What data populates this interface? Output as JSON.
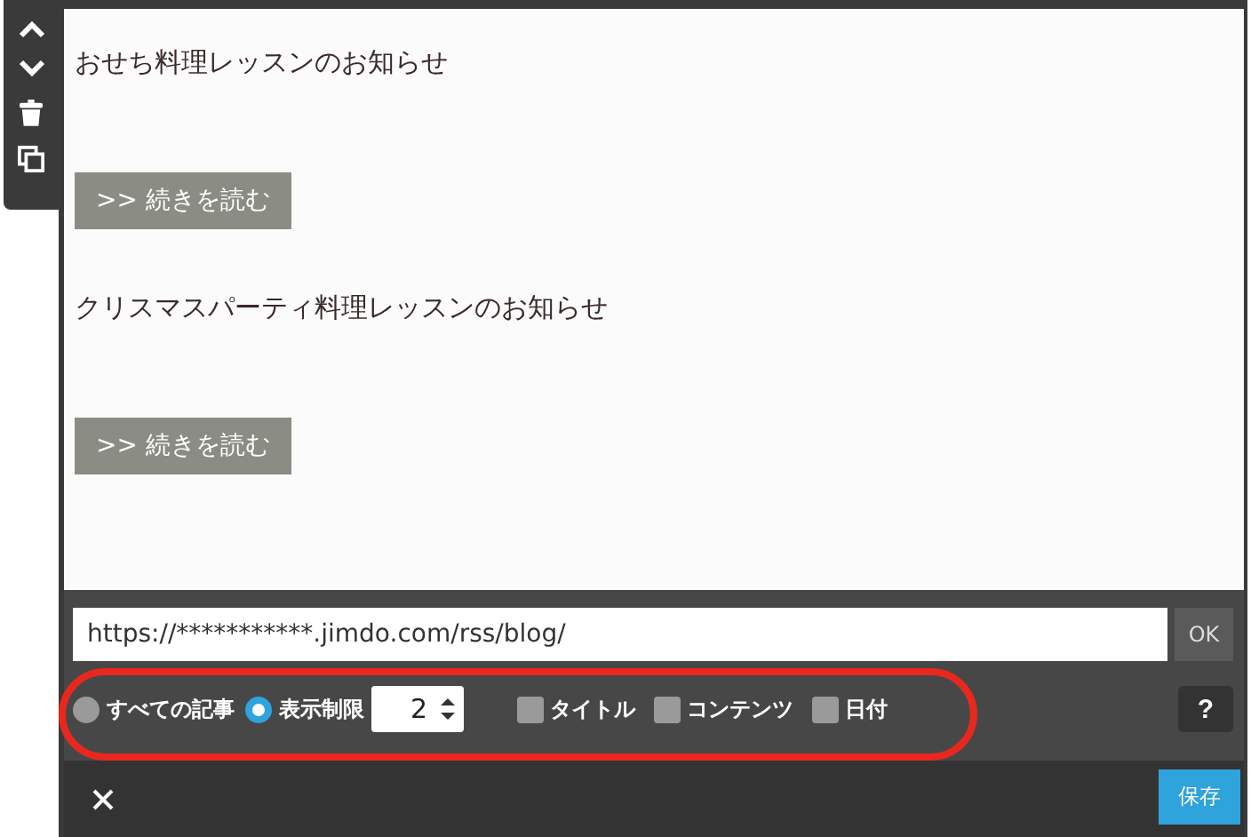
{
  "toolbar": [
    {
      "kind": "up"
    },
    {
      "kind": "down"
    },
    {
      "kind": "trash"
    },
    {
      "kind": "copy"
    }
  ],
  "posts": [
    {
      "title": "おせち料理レッスンのお知らせ",
      "button": ">> 続きを読む"
    },
    {
      "title": "クリスマスパーティ料理レッスンのお知らせ",
      "button": ">> 続きを読む"
    }
  ],
  "feed": {
    "url": "https://***********.jimdo.com/rss/blog/",
    "ok": "OK"
  },
  "options": {
    "radios": [
      {
        "label": "すべての記事",
        "selected": false
      },
      {
        "label": "表示制限",
        "selected": true
      }
    ],
    "limit": "2",
    "checkboxes": [
      {
        "label": "タイトル",
        "checked": false
      },
      {
        "label": "コンテンツ",
        "checked": false
      },
      {
        "label": "日付",
        "checked": false
      }
    ],
    "help": "?"
  },
  "footer": {
    "save": "保存"
  }
}
